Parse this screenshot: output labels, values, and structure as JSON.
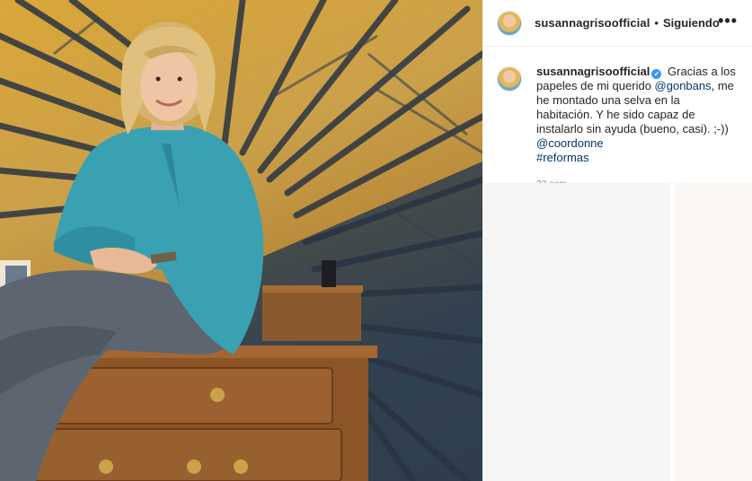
{
  "post": {
    "username": "susannagrisoofficial",
    "follow_separator": "•",
    "follow_label": "Siguiendo",
    "more_label": "•••",
    "verified_mark": "✓"
  },
  "caption": {
    "username": "susannagrisoofficial",
    "text_1": "Gracias a los papeles de mi querido ",
    "mention_1": "@gonbans",
    "text_2": ", me he montado una selva en la habitación. Y he sido capaz de instalarlo sin ayuda (bueno, casi). ;-)) ",
    "mention_2": "@coordonne",
    "hashtag": "#reformas",
    "time": "33 sem"
  },
  "colors": {
    "link": "#00376b",
    "verified": "#3897f0",
    "wallpaper_gold": "#d9a638",
    "wallpaper_dark": "#2d3d4c",
    "blouse": "#3aa1b3"
  },
  "icons": {
    "verified": "verified-badge-icon",
    "more": "more-options-icon"
  }
}
